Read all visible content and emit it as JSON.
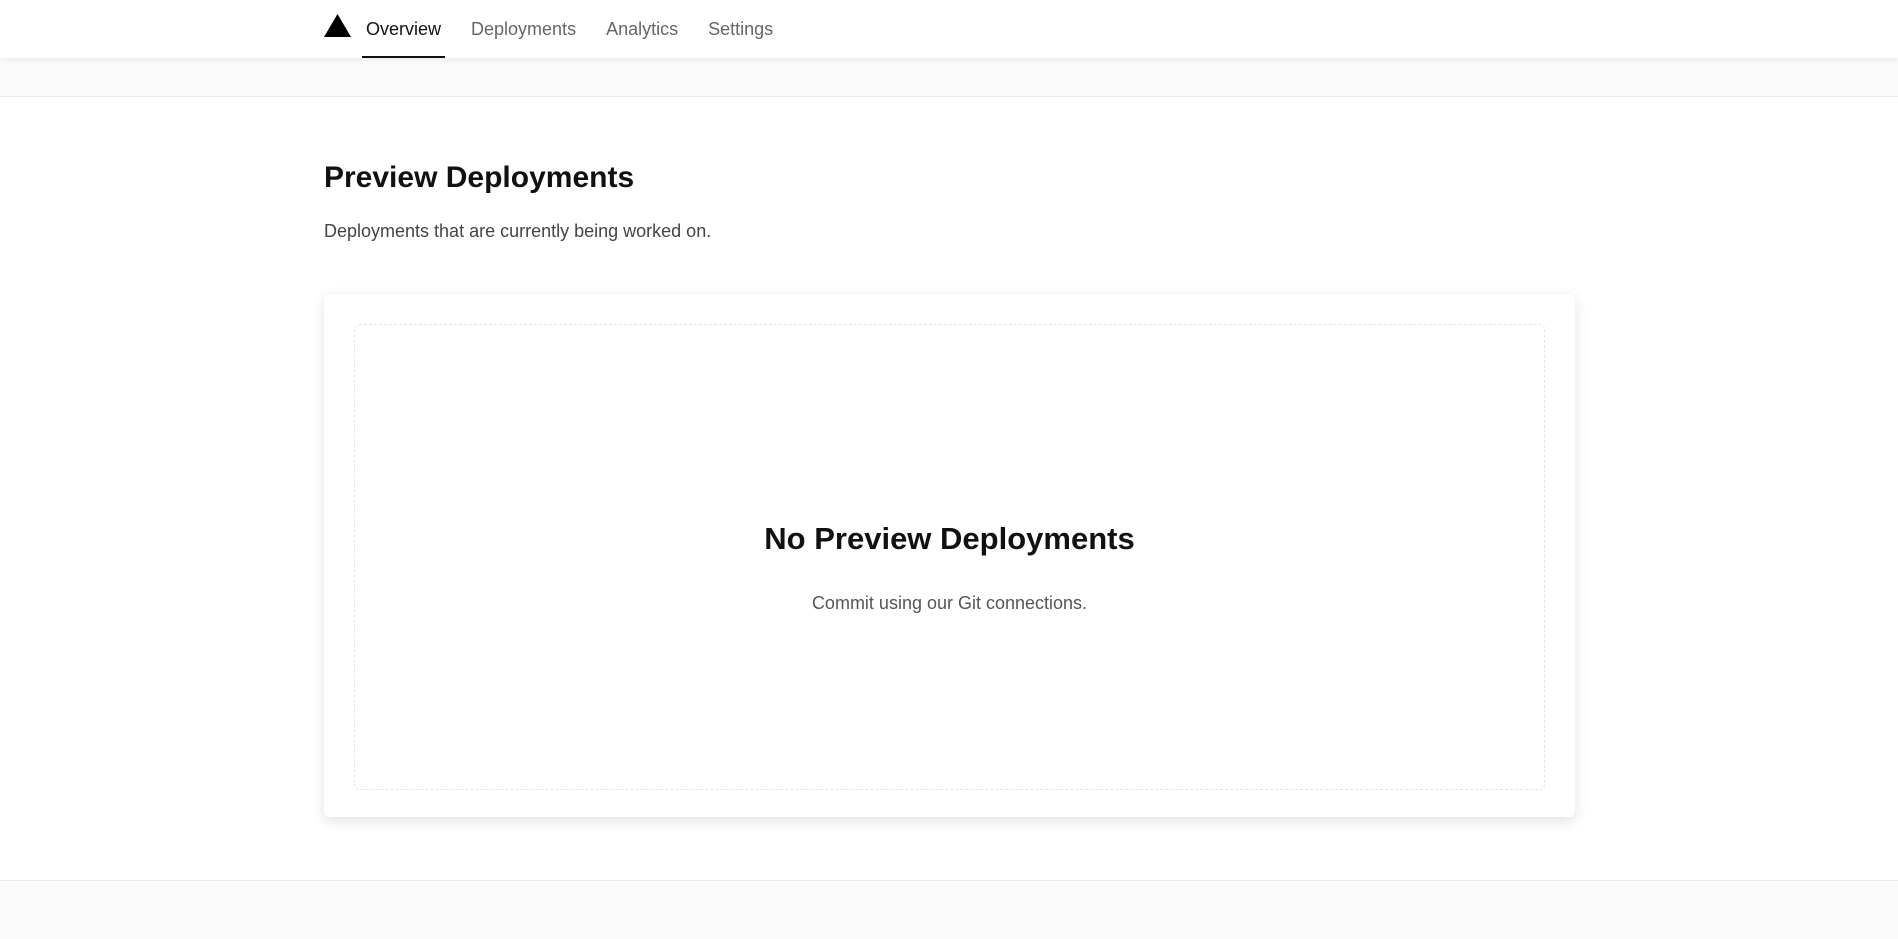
{
  "nav": {
    "logo_icon": "triangle-logo-icon",
    "tabs": [
      {
        "label": "Overview",
        "active": true
      },
      {
        "label": "Deployments",
        "active": false
      },
      {
        "label": "Analytics",
        "active": false
      },
      {
        "label": "Settings",
        "active": false
      }
    ]
  },
  "page": {
    "title": "Preview Deployments",
    "subtitle": "Deployments that are currently being worked on."
  },
  "empty_state": {
    "title": "No Preview Deployments",
    "text": "Commit using our Git connections."
  },
  "colors": {
    "text_primary": "#111111",
    "text_secondary": "#666666",
    "background_muted": "#fafafa",
    "border": "#eaeaea"
  }
}
